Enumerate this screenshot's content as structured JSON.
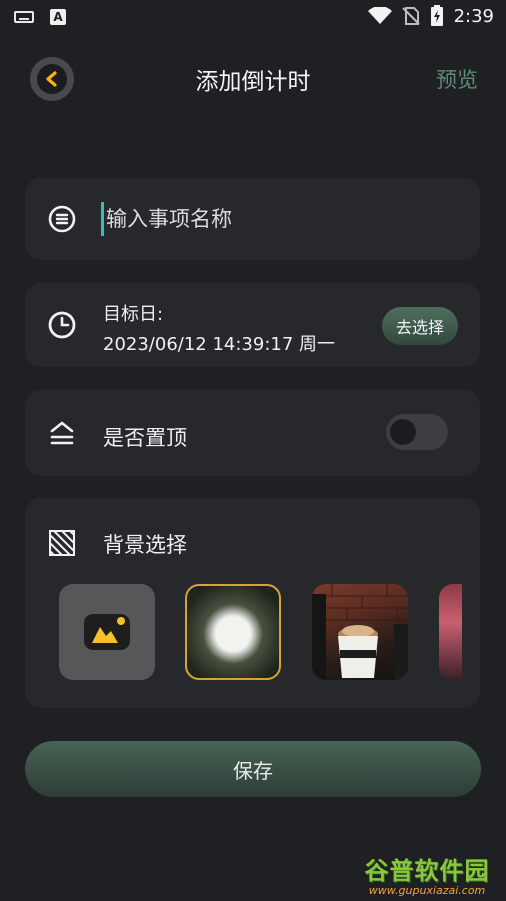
{
  "status_bar": {
    "time": "2:39"
  },
  "header": {
    "title": "添加倒计时",
    "preview_label": "预览"
  },
  "event_name": {
    "placeholder": "输入事项名称",
    "value": ""
  },
  "target_date": {
    "label": "目标日:",
    "value": "2023/06/12 14:39:17 周一",
    "choose_label": "去选择"
  },
  "pin_top": {
    "label": "是否置顶",
    "enabled": false
  },
  "background": {
    "label": "背景选择"
  },
  "save_label": "保存",
  "watermark": {
    "brand": "谷普软件园",
    "url": "www.gupuxiazai.com"
  },
  "colors": {
    "accent_green": "#5f8b73",
    "back_arrow": "#f5b21a",
    "selected_border": "#d5a431"
  }
}
